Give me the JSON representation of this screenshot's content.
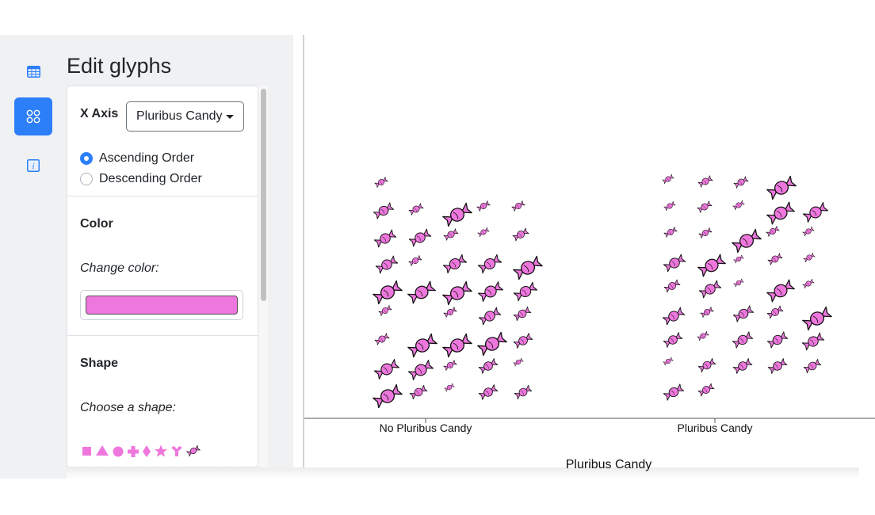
{
  "sidebar": {
    "items": [
      {
        "icon": "table-icon",
        "active": false
      },
      {
        "icon": "glyphs-icon",
        "active": true
      },
      {
        "icon": "info-icon",
        "active": false
      }
    ]
  },
  "panel": {
    "title": "Edit glyphs",
    "x_axis": {
      "label": "X Axis",
      "selected": "Pluribus Candy",
      "order_options": [
        {
          "label": "Ascending Order",
          "checked": true
        },
        {
          "label": "Descending Order",
          "checked": false
        }
      ]
    },
    "color": {
      "heading": "Color",
      "prompt": "Change color:",
      "value": "#ee77dd"
    },
    "shape": {
      "heading": "Shape",
      "prompt": "Choose a shape:",
      "options": [
        "square-icon",
        "triangle-icon",
        "circle-icon",
        "cross-icon",
        "diamond-icon",
        "star-icon",
        "wye-icon",
        "candy-icon"
      ]
    }
  },
  "colors": {
    "accent": "#2d7ff9",
    "glyph": "#ee77dd"
  },
  "chart_data": {
    "type": "scatter",
    "xlabel": "Pluribus Candy",
    "categories": [
      "No Pluribus Candy",
      "Pluribus Candy"
    ],
    "glyph": "candy",
    "counts": [
      40,
      41
    ]
  }
}
